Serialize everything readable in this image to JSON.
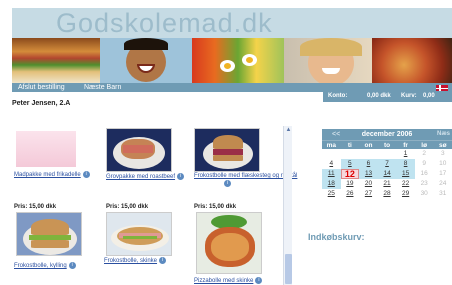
{
  "header": {
    "site_title": "Godskolemad.dk",
    "nav": [
      "Afslut bestilling",
      "Næste Barn"
    ]
  },
  "status": {
    "konto_label": "Konto:",
    "konto_value": "0,00 dkk",
    "kurv_label": "Kurv:",
    "kurv_value": "0,00"
  },
  "user": {
    "name": "Peter Jensen, 2.A"
  },
  "products": [
    {
      "name": "Madpakke med frikadelle",
      "price": ""
    },
    {
      "name": "Grovpakke med roastbeef",
      "price": ""
    },
    {
      "name": "Frokostbolle med flæskesteg og rødkål",
      "price": ""
    },
    {
      "name": "Frokostbolle, kylling",
      "price": "Pris: 15,00 dkk"
    },
    {
      "name": "Frokostbolle, skinke",
      "price": "Pris: 15,00 dkk"
    },
    {
      "name": "Pizzabolle med skinke",
      "price": "Pris: 15,00 dkk"
    }
  ],
  "calendar": {
    "prev": "<<",
    "month_label": "december 2006",
    "next": "Næs",
    "day_names": [
      "ma",
      "ti",
      "on",
      "to",
      "fr",
      "lø",
      "sø"
    ],
    "weeks": [
      [
        "",
        "",
        "",
        "",
        "1",
        "2",
        "3"
      ],
      [
        "4",
        "5",
        "6",
        "7",
        "8",
        "9",
        "10"
      ],
      [
        "11",
        "12",
        "13",
        "14",
        "15",
        "16",
        "17"
      ],
      [
        "18",
        "19",
        "20",
        "21",
        "22",
        "23",
        "24"
      ],
      [
        "25",
        "26",
        "27",
        "28",
        "29",
        "30",
        "31"
      ]
    ],
    "today": "12"
  },
  "cart": {
    "title": "Indkøbskurv:"
  },
  "colors": {
    "accent": "#6f9bb4",
    "link": "#2a4fa0",
    "highlight": "#bfe3f0",
    "today": "#d00000"
  }
}
